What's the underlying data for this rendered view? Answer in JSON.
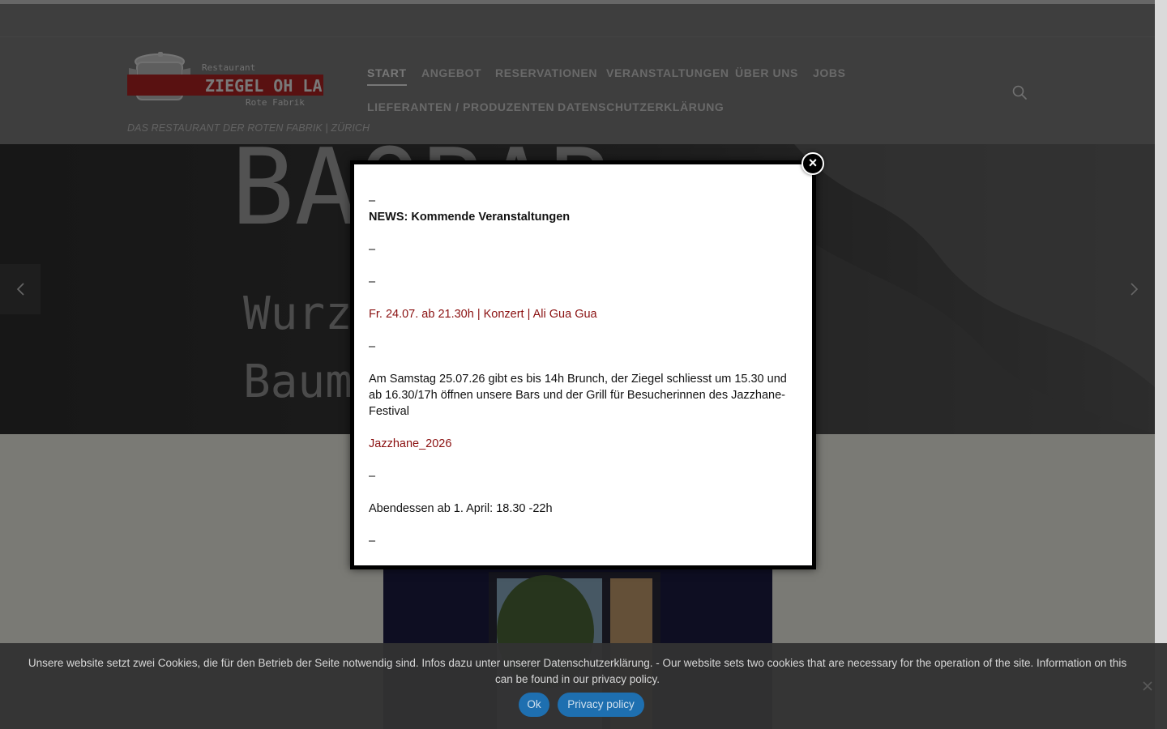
{
  "brand": {
    "logo_top": "Restaurant",
    "logo_main": "ZIEGEL OH LAC",
    "logo_sub": "Rote Fabrik",
    "tagline": "DAS RESTAURANT DER ROTEN FABRIK | ZÜRICH"
  },
  "nav": {
    "items": [
      {
        "label": "START"
      },
      {
        "label": "ANGEBOT"
      },
      {
        "label": "RESERVATIONEN"
      },
      {
        "label": "VERANSTALTUNGEN"
      },
      {
        "label": "ÜBER UNS"
      },
      {
        "label": "JOBS"
      },
      {
        "label": "LIEFERANTEN / PRODUZENTEN"
      },
      {
        "label": "DATENSCHUTZERKLÄRUNG"
      }
    ],
    "search_icon": "search-icon"
  },
  "hero": {
    "image_text": [
      "BAOBAB",
      "Wurz",
      "Baum"
    ],
    "prev_icon": "chevron-left-icon",
    "next_icon": "chevron-right-icon"
  },
  "modal": {
    "dash": "–",
    "title": "NEWS: Kommende Veranstaltungen",
    "event_1": "Fr. 24.07. ab 21.30h | Konzert | Ali Gua Gua",
    "paragraph_1": "Am Samstag 25.07.26 gibt es bis 14h Brunch, der Ziegel schliesst um 15.30 und ab 16.30/17h öffnen unsere Bars und der Grill für Besucherinnen des Jazzhane-Festival",
    "link_1": "Jazzhane_2026",
    "paragraph_2": "Abendessen ab 1. April: 18.30 -22h",
    "close_label": "×"
  },
  "cookie": {
    "text": "Unsere website setzt zwei Cookies, die für den Betrieb der Seite notwendig sind. Infos dazu unter unserer Datenschutzerklärung. - Our website sets two cookies that are necessary for the operation of the site. Information on this can be found in our privacy policy.",
    "ok_label": "Ok",
    "privacy_label": "Privacy policy",
    "close_icon": "close-icon"
  },
  "colors": {
    "header_bg": "#7c7c7c",
    "accent_red": "#8a1010",
    "logo_red": "#b22222",
    "cookie_button": "#1e6fb0"
  }
}
